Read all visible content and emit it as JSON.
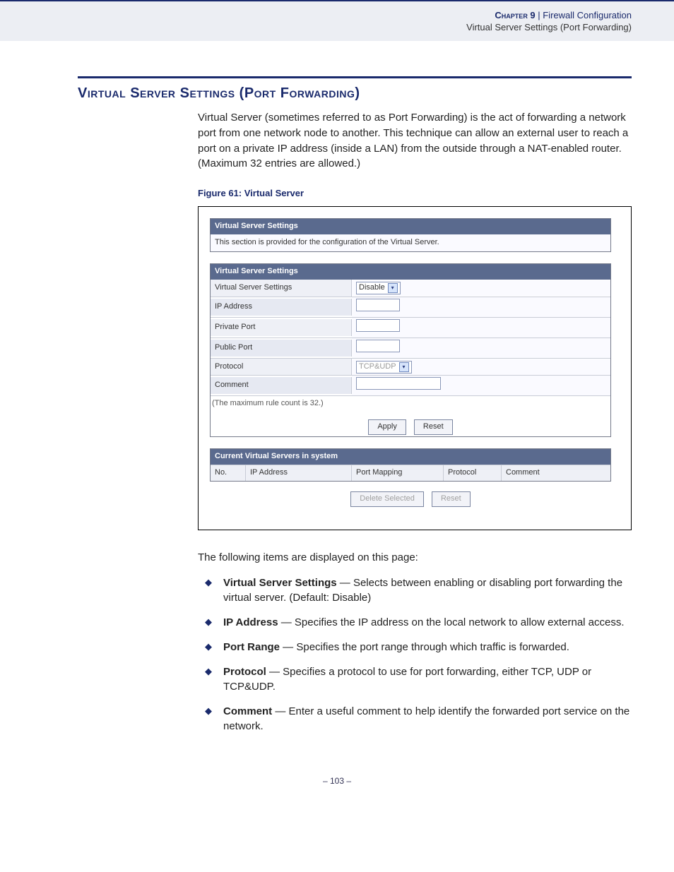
{
  "header": {
    "chapter_label": "Chapter 9",
    "separator": "  |  ",
    "chapter_title": "Firewall Configuration",
    "subtitle": "Virtual Server Settings (Port Forwarding)"
  },
  "section": {
    "title": "Virtual Server Settings (Port Forwarding)",
    "intro": "Virtual Server (sometimes referred to as Port Forwarding) is the act of forwarding a network port from one network node to another. This technique can allow an external user to reach a port on a private IP address (inside a LAN) from the outside through a NAT-enabled router. (Maximum 32 entries are allowed.)"
  },
  "figure": {
    "caption": "Figure 61:  Virtual Server",
    "panel1_title": "Virtual Server Settings",
    "panel1_desc": "This section is provided for the configuration of the Virtual Server.",
    "panel2_title": "Virtual Server Settings",
    "rows": {
      "vss_label": "Virtual Server Settings",
      "vss_value": "Disable",
      "ip_label": "IP Address",
      "private_port_label": "Private Port",
      "public_port_label": "Public Port",
      "protocol_label": "Protocol",
      "protocol_value": "TCP&UDP",
      "comment_label": "Comment"
    },
    "note": "(The maximum rule count is 32.)",
    "apply": "Apply",
    "reset": "Reset",
    "table_title": "Current Virtual Servers in system",
    "thead": {
      "no": "No.",
      "ip": "IP Address",
      "port": "Port Mapping",
      "proto": "Protocol",
      "comment": "Comment"
    },
    "delete_selected": "Delete Selected",
    "reset2": "Reset"
  },
  "after_figure_intro": "The following items are displayed on this page:",
  "items": [
    {
      "term": "Virtual Server Settings",
      "desc": " — Selects between enabling or disabling port forwarding the virtual server. (Default: Disable)"
    },
    {
      "term": "IP Address",
      "desc": " — Specifies the IP address on the local network to allow external access."
    },
    {
      "term": "Port Range",
      "desc": " — Specifies the port range through which traffic is forwarded."
    },
    {
      "term": "Protocol",
      "desc": " — Specifies a protocol to use for port forwarding, either TCP, UDP or TCP&UDP."
    },
    {
      "term": "Comment",
      "desc": " — Enter a useful comment to help identify the forwarded port service on the network."
    }
  ],
  "page_number": "–  103  –"
}
